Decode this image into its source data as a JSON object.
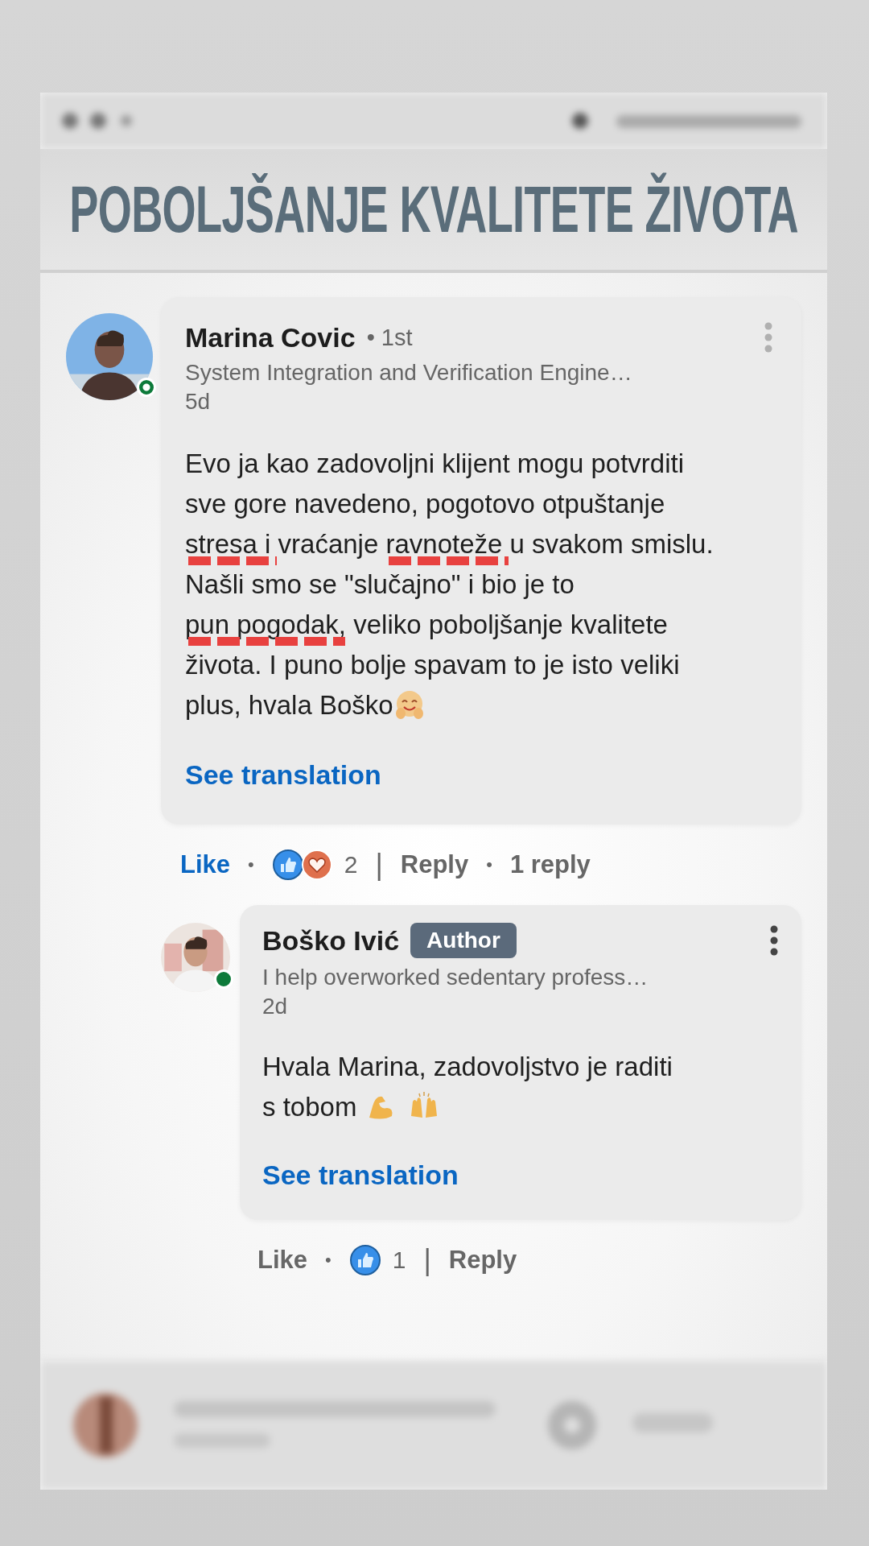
{
  "title": "POBOLJŠANJE KVALITETE ŽIVOTA",
  "comments": [
    {
      "author": "Marina Covic",
      "degree": "• 1st",
      "presence": {
        "kind": "ring"
      },
      "headline": "System Integration and Verification Engine…",
      "time": "5d",
      "body": [
        {
          "text": "Evo ja kao zadovoljni klijent mogu potvrditi sve gore navedeno, pogotovo otpuštanje ",
          "underlined": false
        },
        {
          "text": "stresa i",
          "underlined": true
        },
        {
          "text": " vraćanje ",
          "underlined": false
        },
        {
          "text": "ravnoteže",
          "underlined": true
        },
        {
          "text": " u svakom smislu. Našli smo se \"slučajno\" i bio je to ",
          "underlined": false
        },
        {
          "text": "pun pogodak",
          "underlined": true
        },
        {
          "text": ", veliko poboljšanje kvalitete života. I puno bolje spavam to je isto veliki plus, hvala Boško",
          "underlined": false
        }
      ],
      "emojis": [
        {
          "kind": "hug"
        }
      ],
      "see_translation": "See translation",
      "actions": [
        {
          "kind": "like",
          "text": "Like",
          "on": true
        },
        {
          "kind": "sep",
          "text": "•"
        },
        {
          "kind": "reactions",
          "icons": [
            {
              "kind": "like"
            },
            {
              "kind": "love"
            }
          ],
          "count": "2"
        },
        {
          "kind": "divider",
          "text": "|"
        },
        {
          "kind": "link",
          "text": "Reply"
        },
        {
          "kind": "sep",
          "text": "•"
        },
        {
          "kind": "link",
          "text": "1 reply"
        }
      ],
      "children": [
        {
          "author": "Boško Ivić",
          "badge": "Author",
          "presence": {
            "kind": "dot"
          },
          "headline": "I help overworked sedentary profess…",
          "time": "2d",
          "body": [
            {
              "text": "Hvala Marina, zadovoljstvo je raditi s tobom ",
              "underlined": false
            }
          ],
          "emojis": [
            {
              "kind": "flex"
            },
            {
              "kind": "raised_hands"
            }
          ],
          "see_translation": "See translation",
          "actions": [
            {
              "kind": "like",
              "text": "Like",
              "on": false
            },
            {
              "kind": "sep",
              "text": "•"
            },
            {
              "kind": "reactions",
              "icons": [
                {
                  "kind": "like"
                }
              ],
              "count": "1"
            },
            {
              "kind": "divider",
              "text": "|"
            },
            {
              "kind": "link",
              "text": "Reply"
            }
          ]
        }
      ]
    }
  ]
}
